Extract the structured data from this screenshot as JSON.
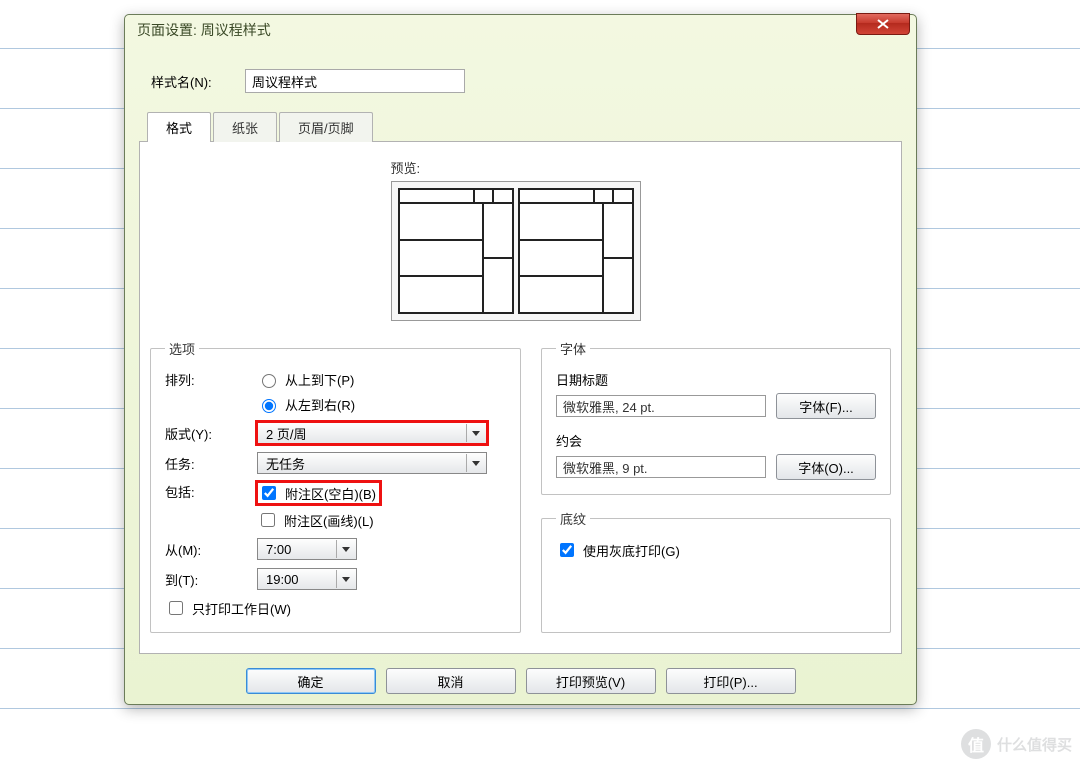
{
  "window": {
    "title": "页面设置: 周议程样式"
  },
  "styleName": {
    "label": "样式名(N):",
    "value": "周议程样式"
  },
  "tabs": {
    "format": "格式",
    "paper": "纸张",
    "headerFooter": "页眉/页脚"
  },
  "preview": {
    "label": "预览:"
  },
  "options": {
    "legend": "选项",
    "arrange": {
      "label": "排列:",
      "topToBottom": "从上到下(P)",
      "leftToRight": "从左到右(R)"
    },
    "layout": {
      "label": "版式(Y):",
      "value": "2 页/周"
    },
    "tasks": {
      "label": "任务:",
      "value": "无任务"
    },
    "include": {
      "label": "包括:",
      "notesBlank": "附注区(空白)(B)",
      "notesLined": "附注区(画线)(L)"
    },
    "from": {
      "label": "从(M):",
      "value": "7:00"
    },
    "to": {
      "label": "到(T):",
      "value": "19:00"
    },
    "workdaysOnly": "只打印工作日(W)"
  },
  "font": {
    "legend": "字体",
    "dateTitle": {
      "label": "日期标题",
      "value": "微软雅黑, 24 pt.",
      "btn": "字体(F)..."
    },
    "appointment": {
      "label": "约会",
      "value": "微软雅黑, 9 pt.",
      "btn": "字体(O)..."
    }
  },
  "shading": {
    "legend": "底纹",
    "grayPrint": "使用灰底打印(G)"
  },
  "buttons": {
    "ok": "确定",
    "cancel": "取消",
    "preview": "打印预览(V)",
    "print": "打印(P)..."
  },
  "watermark": {
    "icon": "值",
    "text": "什么值得买"
  }
}
